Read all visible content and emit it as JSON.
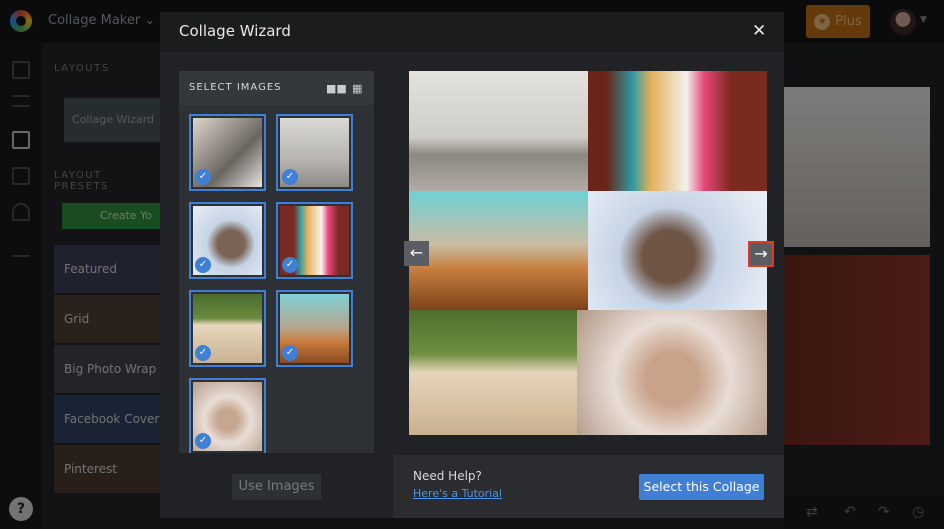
{
  "app": {
    "name": "Collage Maker ⌄",
    "plus_label": "Plus"
  },
  "left_panel": {
    "layouts_heading": "LAYOUTS",
    "wizard_item": "Collage Wizard",
    "presets_heading": "LAYOUT PRESETS",
    "create_button": "Create Yo",
    "presets": [
      "Featured",
      "Grid",
      "Big Photo Wrap",
      "Facebook Cover",
      "Pinterest"
    ]
  },
  "modal": {
    "title": "Collage Wizard",
    "close_icon": "close-icon",
    "select_images": "SELECT IMAGES",
    "use_images": "Use Images",
    "need_help": "Need Help?",
    "tutorial_link": "Here's a Tutorial",
    "select_collage": "Select this Collage"
  },
  "colors": {
    "accent": "#3f7fd6",
    "plus": "#b86a14",
    "highlight": "#e03a22"
  }
}
